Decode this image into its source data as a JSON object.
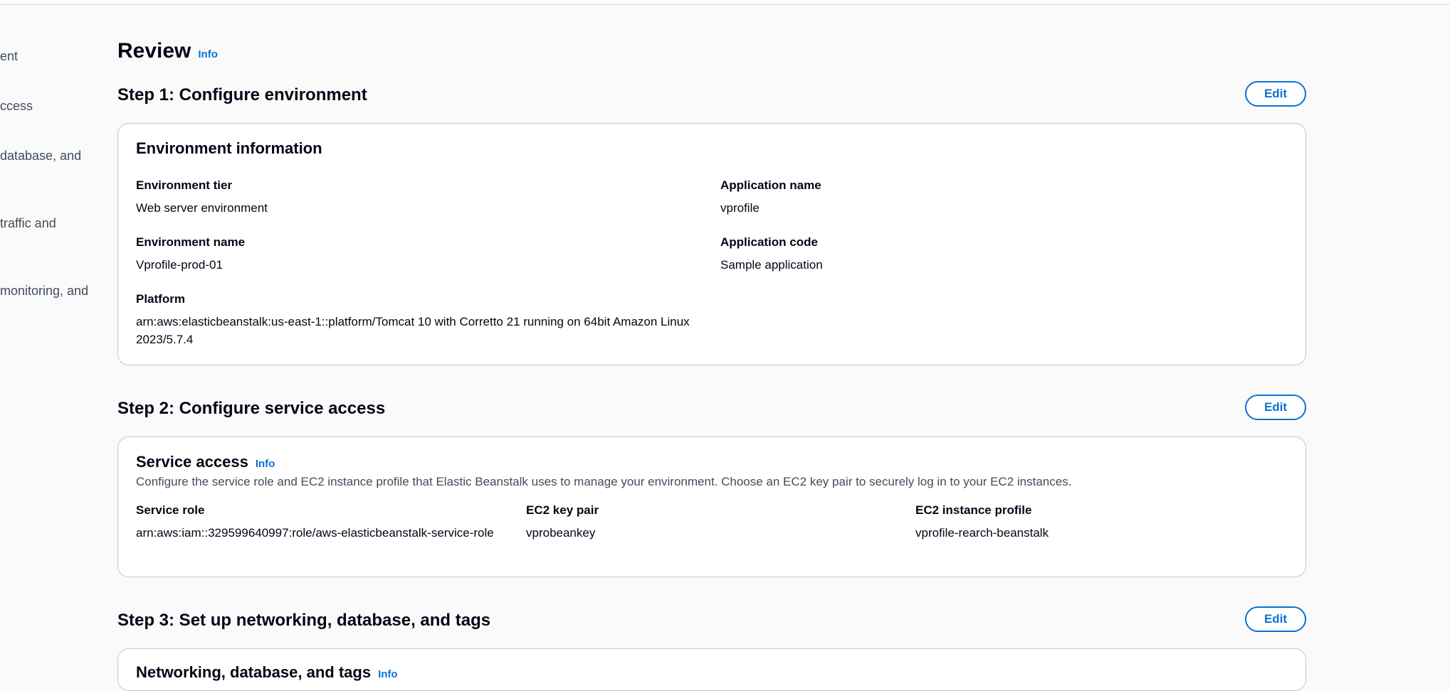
{
  "side_nav": {
    "items": [
      "ent",
      "ccess",
      "database, and",
      "traffic and",
      "monitoring, and"
    ]
  },
  "review": {
    "title": "Review",
    "info_label": "Info"
  },
  "step1": {
    "title": "Step 1: Configure environment",
    "edit_label": "Edit",
    "container_title": "Environment information",
    "fields": {
      "environment_tier": {
        "label": "Environment tier",
        "value": "Web server environment"
      },
      "application_name": {
        "label": "Application name",
        "value": "vprofile"
      },
      "environment_name": {
        "label": "Environment name",
        "value": "Vprofile-prod-01"
      },
      "application_code": {
        "label": "Application code",
        "value": "Sample application"
      },
      "platform": {
        "label": "Platform",
        "value": "arn:aws:elasticbeanstalk:us-east-1::platform/Tomcat 10 with Corretto 21 running on 64bit Amazon Linux 2023/5.7.4"
      }
    }
  },
  "step2": {
    "title": "Step 2: Configure service access",
    "edit_label": "Edit",
    "container_title": "Service access",
    "info_label": "Info",
    "description": "Configure the service role and EC2 instance profile that Elastic Beanstalk uses to manage your environment. Choose an EC2 key pair to securely log in to your EC2 instances.",
    "fields": {
      "service_role": {
        "label": "Service role",
        "value": "arn:aws:iam::329599640997:role/aws-elasticbeanstalk-service-role"
      },
      "ec2_key_pair": {
        "label": "EC2 key pair",
        "value": "vprobeankey"
      },
      "ec2_instance_profile": {
        "label": "EC2 instance profile",
        "value": "vprofile-rearch-beanstalk"
      }
    }
  },
  "step3": {
    "title": "Step 3: Set up networking, database, and tags",
    "edit_label": "Edit",
    "container_title": "Networking, database, and tags",
    "info_label": "Info"
  }
}
